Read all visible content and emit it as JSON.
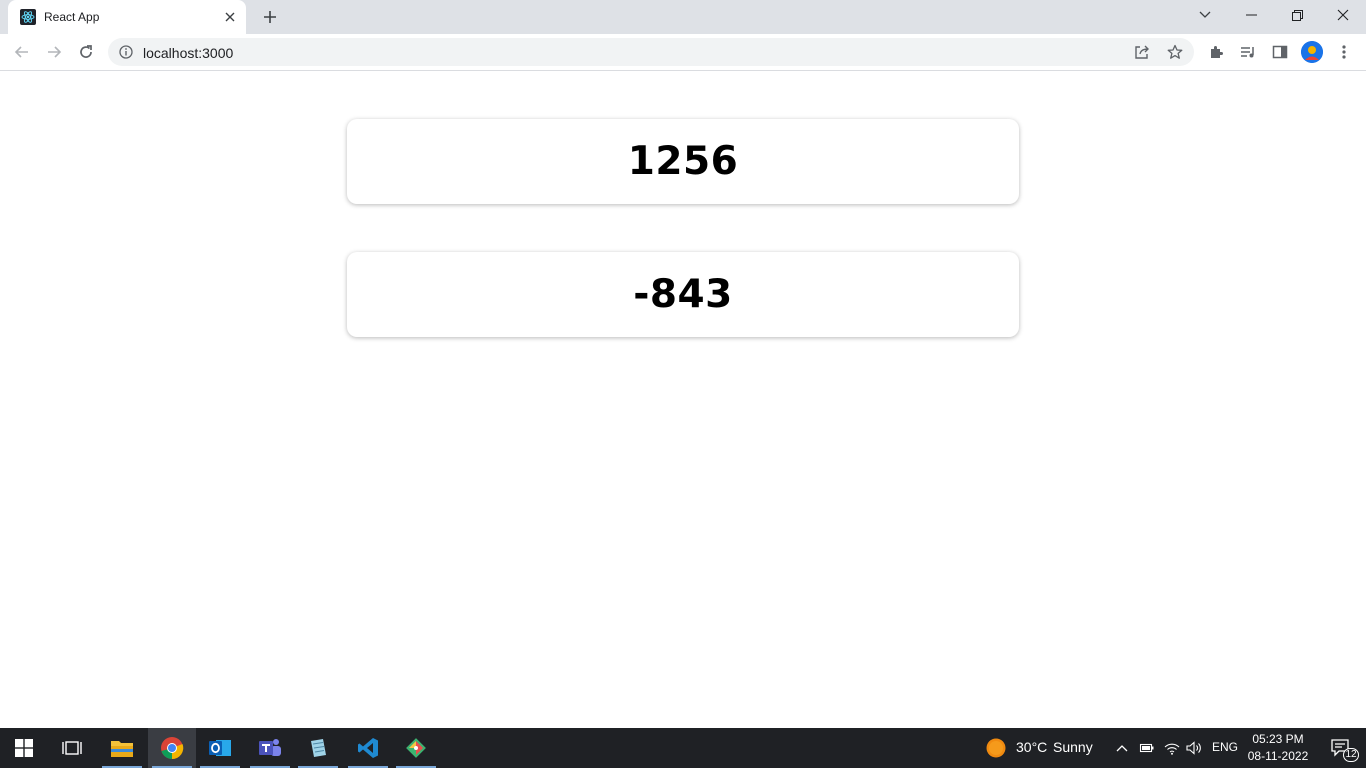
{
  "browser": {
    "tab_title": "React App",
    "url": "localhost:3000"
  },
  "cards": [
    {
      "value": "1256"
    },
    {
      "value": "-843"
    }
  ],
  "taskbar": {
    "weather_temp": "30°C",
    "weather_condition": "Sunny",
    "language": "ENG",
    "time": "05:23 PM",
    "date": "08-11-2022",
    "notification_count": "12"
  },
  "colors": {
    "tabstrip_bg": "#dee1e6",
    "taskbar_bg": "#1f2125",
    "card_text": "#000000"
  }
}
